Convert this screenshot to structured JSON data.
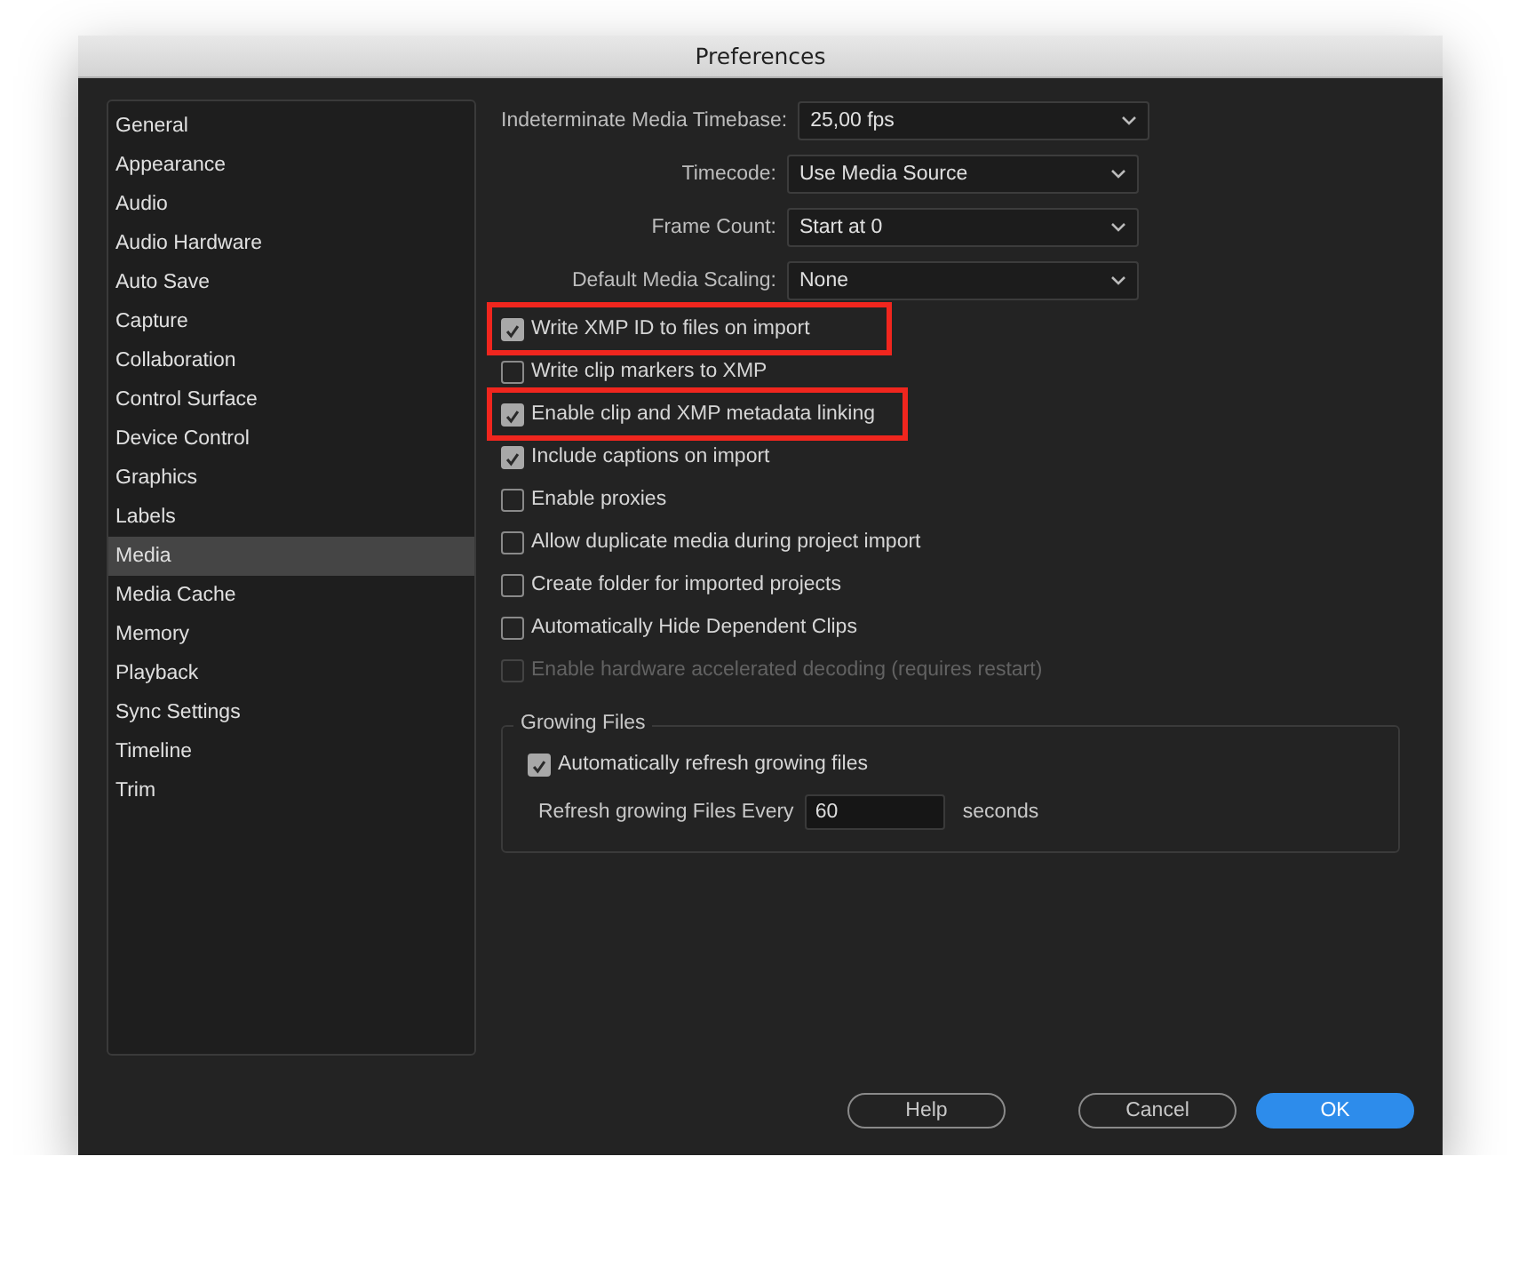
{
  "window": {
    "title": "Preferences"
  },
  "sidebar": {
    "items": [
      {
        "label": "General",
        "selected": false
      },
      {
        "label": "Appearance",
        "selected": false
      },
      {
        "label": "Audio",
        "selected": false
      },
      {
        "label": "Audio Hardware",
        "selected": false
      },
      {
        "label": "Auto Save",
        "selected": false
      },
      {
        "label": "Capture",
        "selected": false
      },
      {
        "label": "Collaboration",
        "selected": false
      },
      {
        "label": "Control Surface",
        "selected": false
      },
      {
        "label": "Device Control",
        "selected": false
      },
      {
        "label": "Graphics",
        "selected": false
      },
      {
        "label": "Labels",
        "selected": false
      },
      {
        "label": "Media",
        "selected": true
      },
      {
        "label": "Media Cache",
        "selected": false
      },
      {
        "label": "Memory",
        "selected": false
      },
      {
        "label": "Playback",
        "selected": false
      },
      {
        "label": "Sync Settings",
        "selected": false
      },
      {
        "label": "Timeline",
        "selected": false
      },
      {
        "label": "Trim",
        "selected": false
      }
    ]
  },
  "dropdowns": [
    {
      "label": "Indeterminate Media Timebase:",
      "value": "25,00 fps"
    },
    {
      "label": "Timecode:",
      "value": "Use Media Source"
    },
    {
      "label": "Frame Count:",
      "value": "Start at 0"
    },
    {
      "label": "Default Media Scaling:",
      "value": "None"
    }
  ],
  "checkboxes": [
    {
      "label": "Write XMP ID to files on import",
      "checked": true,
      "disabled": false,
      "highlighted": true
    },
    {
      "label": "Write clip markers to XMP",
      "checked": false,
      "disabled": false,
      "highlighted": false
    },
    {
      "label": "Enable clip and XMP metadata linking",
      "checked": true,
      "disabled": false,
      "highlighted": true
    },
    {
      "label": "Include captions on import",
      "checked": true,
      "disabled": false,
      "highlighted": false
    },
    {
      "label": "Enable proxies",
      "checked": false,
      "disabled": false,
      "highlighted": false
    },
    {
      "label": "Allow duplicate media during project import",
      "checked": false,
      "disabled": false,
      "highlighted": false
    },
    {
      "label": "Create folder for imported projects",
      "checked": false,
      "disabled": false,
      "highlighted": false
    },
    {
      "label": "Automatically Hide Dependent Clips",
      "checked": false,
      "disabled": false,
      "highlighted": false
    },
    {
      "label": "Enable hardware accelerated decoding (requires restart)",
      "checked": false,
      "disabled": true,
      "highlighted": false
    }
  ],
  "growing_files": {
    "title": "Growing Files",
    "checkbox": {
      "label": "Automatically refresh growing files",
      "checked": true
    },
    "field": {
      "label": "Refresh growing Files Every",
      "value": "60",
      "unit": "seconds"
    }
  },
  "buttons": [
    {
      "label": "Help",
      "kind": "secondary"
    },
    {
      "label": "Cancel",
      "kind": "secondary"
    },
    {
      "label": "OK",
      "kind": "primary"
    }
  ]
}
